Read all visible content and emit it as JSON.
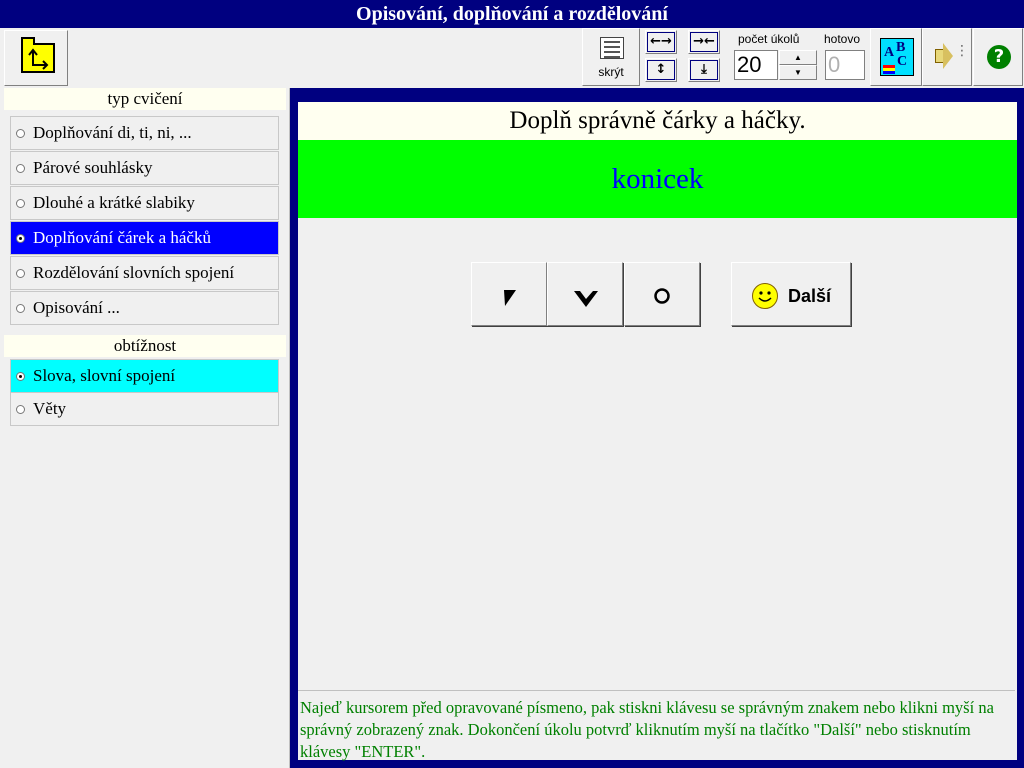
{
  "window": {
    "title": "Opisování, doplňování a rozdělování"
  },
  "toolbar": {
    "open_icon": "folder-up-icon",
    "hide_label": "skrýt",
    "count_label": "počet úkolů",
    "count_value": "20",
    "done_label": "hotovo",
    "done_value": "0",
    "arrows": {
      "widen": "←→",
      "narrow": "→←",
      "taller": "↕",
      "shorter": "⤓"
    },
    "spin_up": "▲",
    "spin_down": "▼",
    "help_glyph": "?",
    "abc_letters": {
      "a": "A",
      "b": "B",
      "c": "C"
    }
  },
  "sidebar": {
    "type_header": "typ cvičení",
    "types": [
      {
        "label": "Doplňování di, ti, ni, ..."
      },
      {
        "label": "Párové souhlásky"
      },
      {
        "label": "Dlouhé a krátké slabiky"
      },
      {
        "label": "Doplňování čárek a háčků"
      },
      {
        "label": "Rozdělování slovních spojení"
      },
      {
        "label": "Opisování ..."
      }
    ],
    "selected_type_index": 3,
    "difficulty_header": "obtížnost",
    "difficulties": [
      {
        "label": "Slova, slovní spojení"
      },
      {
        "label": "Věty"
      }
    ],
    "selected_difficulty_index": 0
  },
  "exercise": {
    "instruction": "Doplň správně čárky a háčky.",
    "word": "konicek",
    "next_label": "Další",
    "hint": "Najeď kursorem před opravované písmeno, pak stiskni klávesu se správným znakem nebo klikni myší na správný zobrazený znak. Dokončení úkolu potvrď kliknutím myší na tlačítko \"Další\" nebo stisknutím klávesy \"ENTER\"."
  },
  "colors": {
    "title_bar": "#000080",
    "selected_type": "#0000ff",
    "selected_difficulty": "#00ffff",
    "word_band": "#00ff00",
    "word_text": "#0000ff",
    "hint_text": "#008000"
  }
}
